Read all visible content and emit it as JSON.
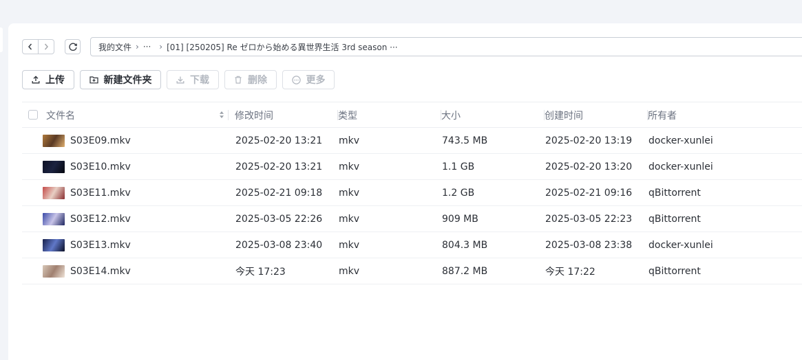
{
  "nav": {
    "back_icon": "chevron-left-icon",
    "forward_icon": "chevron-right-icon",
    "refresh_icon": "refresh-icon"
  },
  "breadcrumb": {
    "root": "我的文件",
    "ellipsis": "···",
    "current": "[01] [250205] Re ゼロから始める異世界生活 3rd season ···",
    "separator": "›"
  },
  "toolbar": {
    "upload_label": "上传",
    "new_folder_label": "新建文件夹",
    "download_label": "下载",
    "delete_label": "删除",
    "more_label": "更多"
  },
  "columns": {
    "name": "文件名",
    "modified": "修改时间",
    "type": "类型",
    "size": "大小",
    "created": "创建时间",
    "owner": "所有者"
  },
  "rows": [
    {
      "name": "S03E09.mkv",
      "modified": "2025-02-20 13:21",
      "type": "mkv",
      "size": "743.5 MB",
      "created": "2025-02-20 13:19",
      "owner": "docker-xunlei",
      "thumb": [
        "#b07a3c",
        "#5a3a24",
        "#e0b070"
      ]
    },
    {
      "name": "S03E10.mkv",
      "modified": "2025-02-20 13:21",
      "type": "mkv",
      "size": "1.1 GB",
      "created": "2025-02-20 13:20",
      "owner": "docker-xunlei",
      "thumb": [
        "#0c1024",
        "#1b2240",
        "#05070f"
      ]
    },
    {
      "name": "S03E11.mkv",
      "modified": "2025-02-21 09:18",
      "type": "mkv",
      "size": "1.2 GB",
      "created": "2025-02-21 09:16",
      "owner": "qBittorrent",
      "thumb": [
        "#c44a48",
        "#e8cfc4",
        "#8a2e30"
      ]
    },
    {
      "name": "S03E12.mkv",
      "modified": "2025-03-05 22:26",
      "type": "mkv",
      "size": "909 MB",
      "created": "2025-03-05 22:23",
      "owner": "qBittorrent",
      "thumb": [
        "#3a4aa8",
        "#c8c4e8",
        "#1e2660"
      ]
    },
    {
      "name": "S03E13.mkv",
      "modified": "2025-03-08 23:40",
      "type": "mkv",
      "size": "804.3 MB",
      "created": "2025-03-08 23:38",
      "owner": "docker-xunlei",
      "thumb": [
        "#18204a",
        "#6078c8",
        "#0a0e26"
      ]
    },
    {
      "name": "S03E14.mkv",
      "modified": "今天 17:23",
      "type": "mkv",
      "size": "887.2 MB",
      "created": "今天 17:22",
      "owner": "qBittorrent",
      "thumb": [
        "#d8c8b8",
        "#a08070",
        "#f0e4d8"
      ]
    }
  ]
}
